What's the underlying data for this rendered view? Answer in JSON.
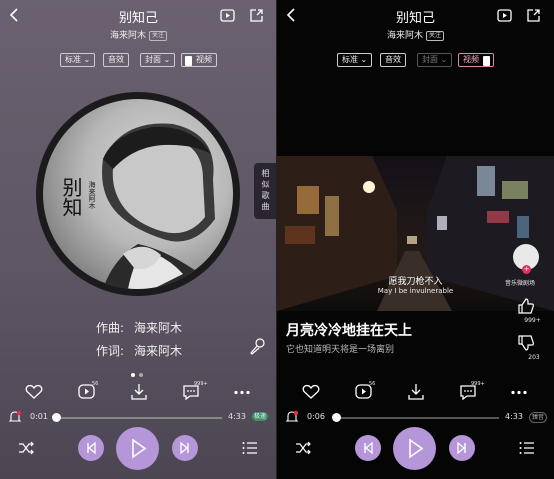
{
  "song": {
    "title": "别知己",
    "artist": "海来阿木",
    "follow_label": "关注"
  },
  "left": {
    "chips": {
      "quality": "标准",
      "effect": "音效",
      "cover": "封面",
      "video": "视频"
    },
    "side_tab": [
      "相",
      "似",
      "歌",
      "曲"
    ],
    "album_text": {
      "vertical_title": "别知",
      "vertical_artist": "海来阿木"
    },
    "credits": {
      "composer_label": "作曲:",
      "composer": "海来阿木",
      "lyricist_label": "作词:",
      "lyricist": "海来阿木"
    },
    "comment_count": "56",
    "share_count": "999+",
    "time_current": "0:01",
    "time_total": "4:33",
    "quality_badge": "极速",
    "progress": 0.004
  },
  "right": {
    "chips": {
      "quality": "标准",
      "effect": "音效",
      "cover": "封面",
      "video": "视频"
    },
    "video_caption_cn": "愿我刀枪不入",
    "video_caption_en": "May I be invulnerable",
    "video_source": "音乐微剧场",
    "likes": "999+",
    "dislikes": "203",
    "lyric_current": "月亮冷冷地挂在天上",
    "lyric_next": "它也知道明天将是一场离别",
    "comment_count": "56",
    "share_count": "999+",
    "time_current": "0:06",
    "time_total": "4:33",
    "quality_badge": "臻音",
    "progress": 0.022
  },
  "colors": {
    "accent": "#b496d9",
    "left_bg": "#5e5664",
    "right_bg": "#050505",
    "video_toggle_pink": "#f2a8c0"
  }
}
